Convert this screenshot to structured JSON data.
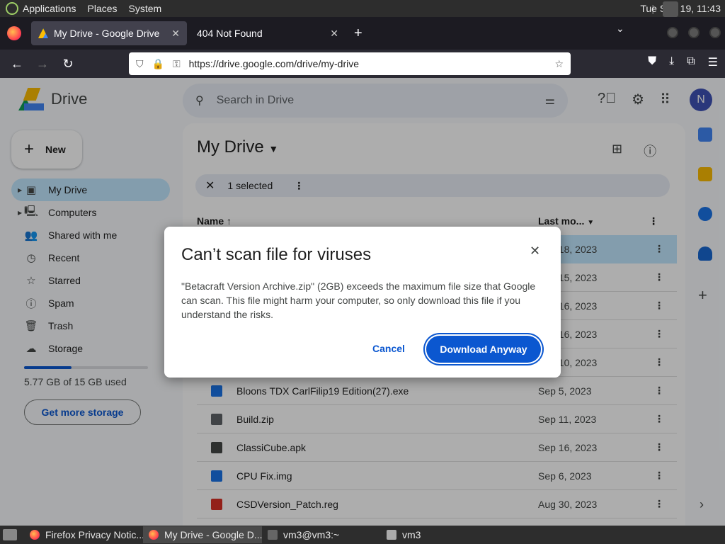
{
  "topbar": {
    "menus": [
      "Applications",
      "Places",
      "System"
    ],
    "clock": "Tue Sep 19, 11:43"
  },
  "browser": {
    "tabs": [
      {
        "title": "My Drive - Google Drive",
        "active": true
      },
      {
        "title": "404 Not Found",
        "active": false
      }
    ],
    "url": "https://drive.google.com/drive/my-drive"
  },
  "drive": {
    "app_name": "Drive",
    "search_placeholder": "Search in Drive",
    "avatar_letter": "N",
    "new_label": "New",
    "sidebar": [
      {
        "label": "My Drive",
        "icon": "my-drive-icon",
        "glyph": "▣",
        "active": true,
        "expandable": true
      },
      {
        "label": "Computers",
        "icon": "computers-icon",
        "glyph": "🖳",
        "active": false,
        "expandable": true
      },
      {
        "label": "Shared with me",
        "icon": "shared-icon",
        "glyph": "👥",
        "active": false,
        "expandable": false
      },
      {
        "label": "Recent",
        "icon": "recent-icon",
        "glyph": "◷",
        "active": false,
        "expandable": false
      },
      {
        "label": "Starred",
        "icon": "star-icon",
        "glyph": "☆",
        "active": false,
        "expandable": false
      },
      {
        "label": "Spam",
        "icon": "spam-icon",
        "glyph": "ⓘ",
        "active": false,
        "expandable": false
      },
      {
        "label": "Trash",
        "icon": "trash-icon",
        "glyph": "🗑",
        "active": false,
        "expandable": false
      },
      {
        "label": "Storage",
        "icon": "cloud-icon",
        "glyph": "☁",
        "active": false,
        "expandable": false
      }
    ],
    "storage": {
      "used_text": "5.77 GB of 15 GB used",
      "used_fraction": 0.385,
      "button": "Get more storage"
    },
    "main_title": "My Drive",
    "selection": "1 selected",
    "columns": {
      "name": "Name",
      "modified": "Last mo..."
    },
    "files": [
      {
        "name": "Betacraft Version Archive.zip",
        "date": "Sep 18, 2023",
        "color": "#5f6368",
        "selected": true
      },
      {
        "name": "",
        "date": "Sep 15, 2023",
        "color": "#5f6368",
        "selected": false
      },
      {
        "name": "",
        "date": "Sep 16, 2023",
        "color": "#5f6368",
        "selected": false
      },
      {
        "name": "",
        "date": "Sep 16, 2023",
        "color": "#5f6368",
        "selected": false
      },
      {
        "name": "",
        "date": "Sep 10, 2023",
        "color": "#5f6368",
        "selected": false
      },
      {
        "name": "Bloons TDX CarlFilip19 Edition(27).exe",
        "date": "Sep 5, 2023",
        "color": "#1a73e8",
        "selected": false
      },
      {
        "name": "Build.zip",
        "date": "Sep 11, 2023",
        "color": "#5f6368",
        "selected": false
      },
      {
        "name": "ClassiCube.apk",
        "date": "Sep 16, 2023",
        "color": "#444746",
        "selected": false
      },
      {
        "name": "CPU Fix.img",
        "date": "Sep 6, 2023",
        "color": "#1a73e8",
        "selected": false
      },
      {
        "name": "CSDVersion_Patch.reg",
        "date": "Aug 30, 2023",
        "color": "#d93025",
        "selected": false
      }
    ]
  },
  "dialog": {
    "title": "Can’t scan file for viruses",
    "body": "\"Betacraft Version Archive.zip\" (2GB) exceeds the maximum file size that Google can scan. This file might harm your computer, so only download this file if you understand the risks.",
    "cancel": "Cancel",
    "download": "Download Anyway"
  },
  "taskbar": [
    {
      "label": "Firefox Privacy Notic...",
      "kind": "tb-ff",
      "active": false
    },
    {
      "label": "My Drive - Google D...",
      "kind": "tb-ff",
      "active": true
    },
    {
      "label": "vm3@vm3:~",
      "kind": "tb-term",
      "active": false
    },
    {
      "label": "vm3",
      "kind": "tb-folder",
      "active": false
    }
  ]
}
